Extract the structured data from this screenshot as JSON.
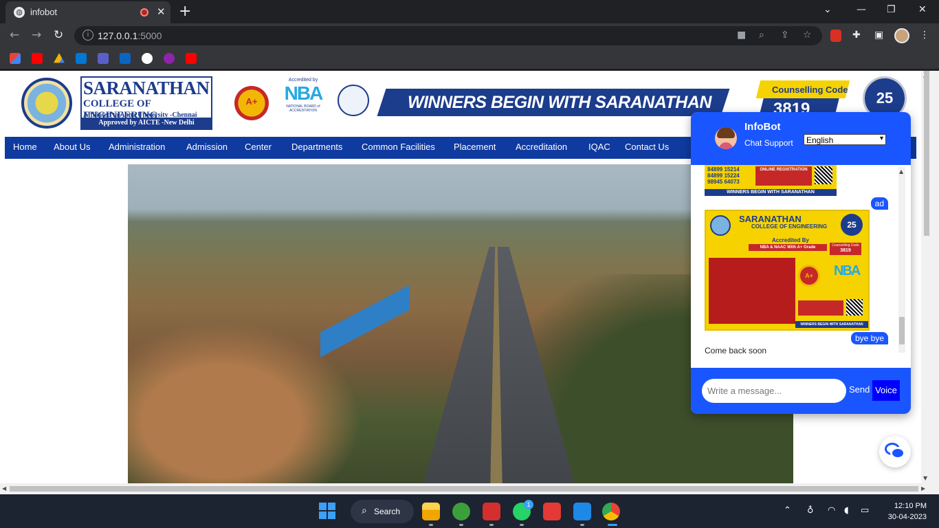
{
  "browser": {
    "tab_title": "infobot",
    "favicon": "globe-icon",
    "url_host": "127.0.0.1",
    "url_port": ":5000",
    "window_controls": [
      "minimize-icon",
      "restore-icon",
      "close-icon"
    ],
    "bookmarks": [
      "gmail",
      "youtube",
      "google-drive",
      "outlook",
      "teams",
      "linkedin",
      "google",
      "app-u",
      "youtube"
    ]
  },
  "college": {
    "name": "SARANATHAN",
    "sub": "COLLEGE OF ENGINEERING",
    "affiliation": "Affiliated to Anna University -Chennai",
    "approval": "Approved by AICTE -New Delhi",
    "naac": "A+",
    "nba_top": "Accredited by",
    "nba": "NBA",
    "nba_bottom": "NATIONAL BOARD of ACCREDITATION",
    "banner": "WINNERS BEGIN WITH SARANATHAN",
    "counselling_label": "Counselling Code",
    "counselling_code": "3819",
    "anniversary": "25"
  },
  "nav": [
    "Home",
    "About Us",
    "Administration",
    "Admission",
    "Center",
    "Departments",
    "Common Facilities",
    "Placement",
    "Accreditation",
    "IQAC",
    "Contact Us"
  ],
  "chatbot": {
    "name": "InfoBot",
    "subtitle": "Chat Support",
    "language": "English",
    "messages": [
      {
        "from": "user",
        "text": "ad"
      },
      {
        "from": "user",
        "text": "bye bye"
      },
      {
        "from": "bot",
        "text": "Come back soon"
      }
    ],
    "poster_top": {
      "phones": "84899 15214\n84899 15224\n98945 64073",
      "registration": "ONLINE REGISTRATION",
      "footer": "WINNERS BEGIN WITH SARANATHAN"
    },
    "poster": {
      "title": "SARANATHAN",
      "subtitle": "COLLEGE OF ENGINEERING",
      "accredited": "Accredited By",
      "accreditation": "NBA & NAAC With A+ Grade",
      "code_label": "Counselling Code",
      "code": "3819",
      "naac": "A+",
      "nba": "NBA",
      "footer": "WINNERS BEGIN WITH SARANATHAN",
      "anniversary": "25"
    },
    "input_placeholder": "Write a message...",
    "send_label": "Send",
    "voice_label": "Voice"
  },
  "taskbar": {
    "search_label": "Search",
    "whatsapp_badge": "1",
    "time": "12:10 PM",
    "date": "30-04-2023"
  }
}
